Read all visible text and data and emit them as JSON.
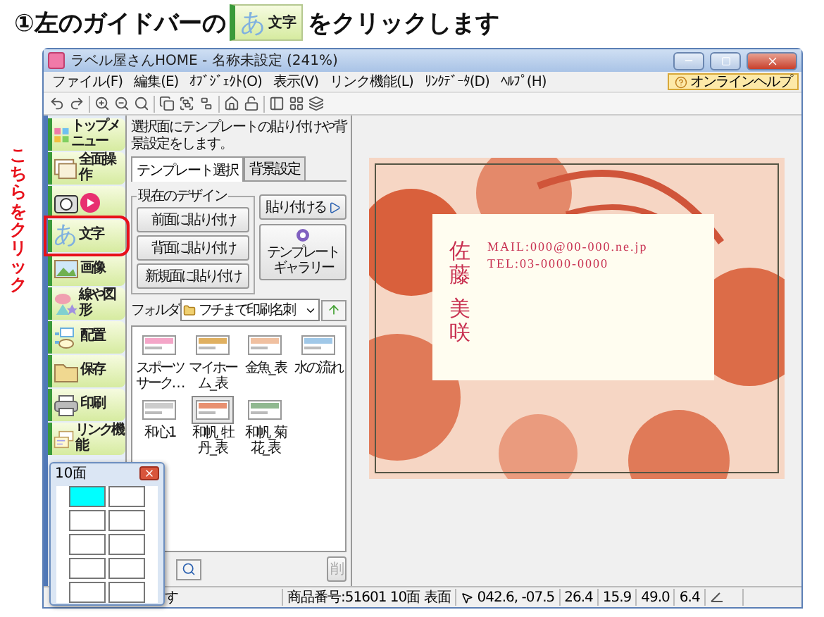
{
  "instruction": {
    "before": "①左のガイドバーの",
    "glyph": "あ",
    "label": "文字",
    "after": "をクリックします"
  },
  "callout": "こちらをクリック",
  "window": {
    "title": "ラベル屋さんHOME - 名称未設定 (241%)"
  },
  "menu": [
    "ファイル(F)",
    "編集(E)",
    "ｵﾌﾞｼﾞｪｸﾄ(O)",
    "表示(V)",
    "リンク機能(L)",
    "ﾘﾝｸﾃﾞｰﾀ(D)",
    "ﾍﾙﾌﾟ(H)"
  ],
  "online_help": "オンラインヘルプ",
  "guide_bar": [
    {
      "label": "トップメニュー",
      "selected": false
    },
    {
      "label": "全面操作",
      "selected": false
    },
    {
      "selected": false
    },
    {
      "glyph": "あ",
      "label": "文字",
      "selected": true
    },
    {
      "label": "画像",
      "selected": false
    },
    {
      "label": "線や図形",
      "selected": false
    },
    {
      "label": "配置",
      "selected": false
    },
    {
      "label": "保存",
      "selected": false
    },
    {
      "label": "印刷",
      "selected": false
    },
    {
      "label": "リンク機能",
      "selected": false
    }
  ],
  "panel": {
    "description": "選択面にテンプレートの貼り付けや背景設定をします。",
    "tabs": [
      {
        "label": "テンプレート選択",
        "selected": true
      },
      {
        "label": "背景設定",
        "selected": false
      }
    ],
    "group": {
      "title": "現在のデザイン",
      "buttons": [
        "前面に貼り付け",
        "背面に貼り付け",
        "新規面に貼り付け"
      ]
    },
    "paste_button": "貼り付ける",
    "gallery_button": "テンプレートギャラリー",
    "folder": {
      "label": "フォルダ",
      "value": "フチまで印刷名刺"
    },
    "templates": [
      {
        "name": "スポーツサーク…",
        "selected": false
      },
      {
        "name": "マイホーム_表",
        "selected": false
      },
      {
        "name": "金魚_表",
        "selected": false
      },
      {
        "name": "水の流れ",
        "selected": false
      },
      {
        "name": "和心1",
        "selected": false
      },
      {
        "name": "和帆_牡丹_表",
        "selected": true
      },
      {
        "name": "和帆_菊花_表",
        "selected": false
      }
    ],
    "delete_button": "削"
  },
  "card": {
    "name": [
      "佐藤",
      "美咲"
    ],
    "mail": "MAIL:000@00-000.ne.jp",
    "tel": "TEL:03-0000-0000"
  },
  "status": {
    "message": "す",
    "product": "商品番号:51601 10面 表面",
    "position": "042.6, -07.5",
    "readings": [
      "26.4",
      "15.9",
      "49.0",
      "6.4"
    ]
  },
  "popup": {
    "title": "10面",
    "cells": [
      {
        "selected": true
      },
      {
        "selected": false
      },
      {
        "selected": false
      },
      {
        "selected": false
      },
      {
        "selected": false
      },
      {
        "selected": false
      },
      {
        "selected": false
      },
      {
        "selected": false
      },
      {
        "selected": false
      },
      {
        "selected": false
      }
    ]
  }
}
